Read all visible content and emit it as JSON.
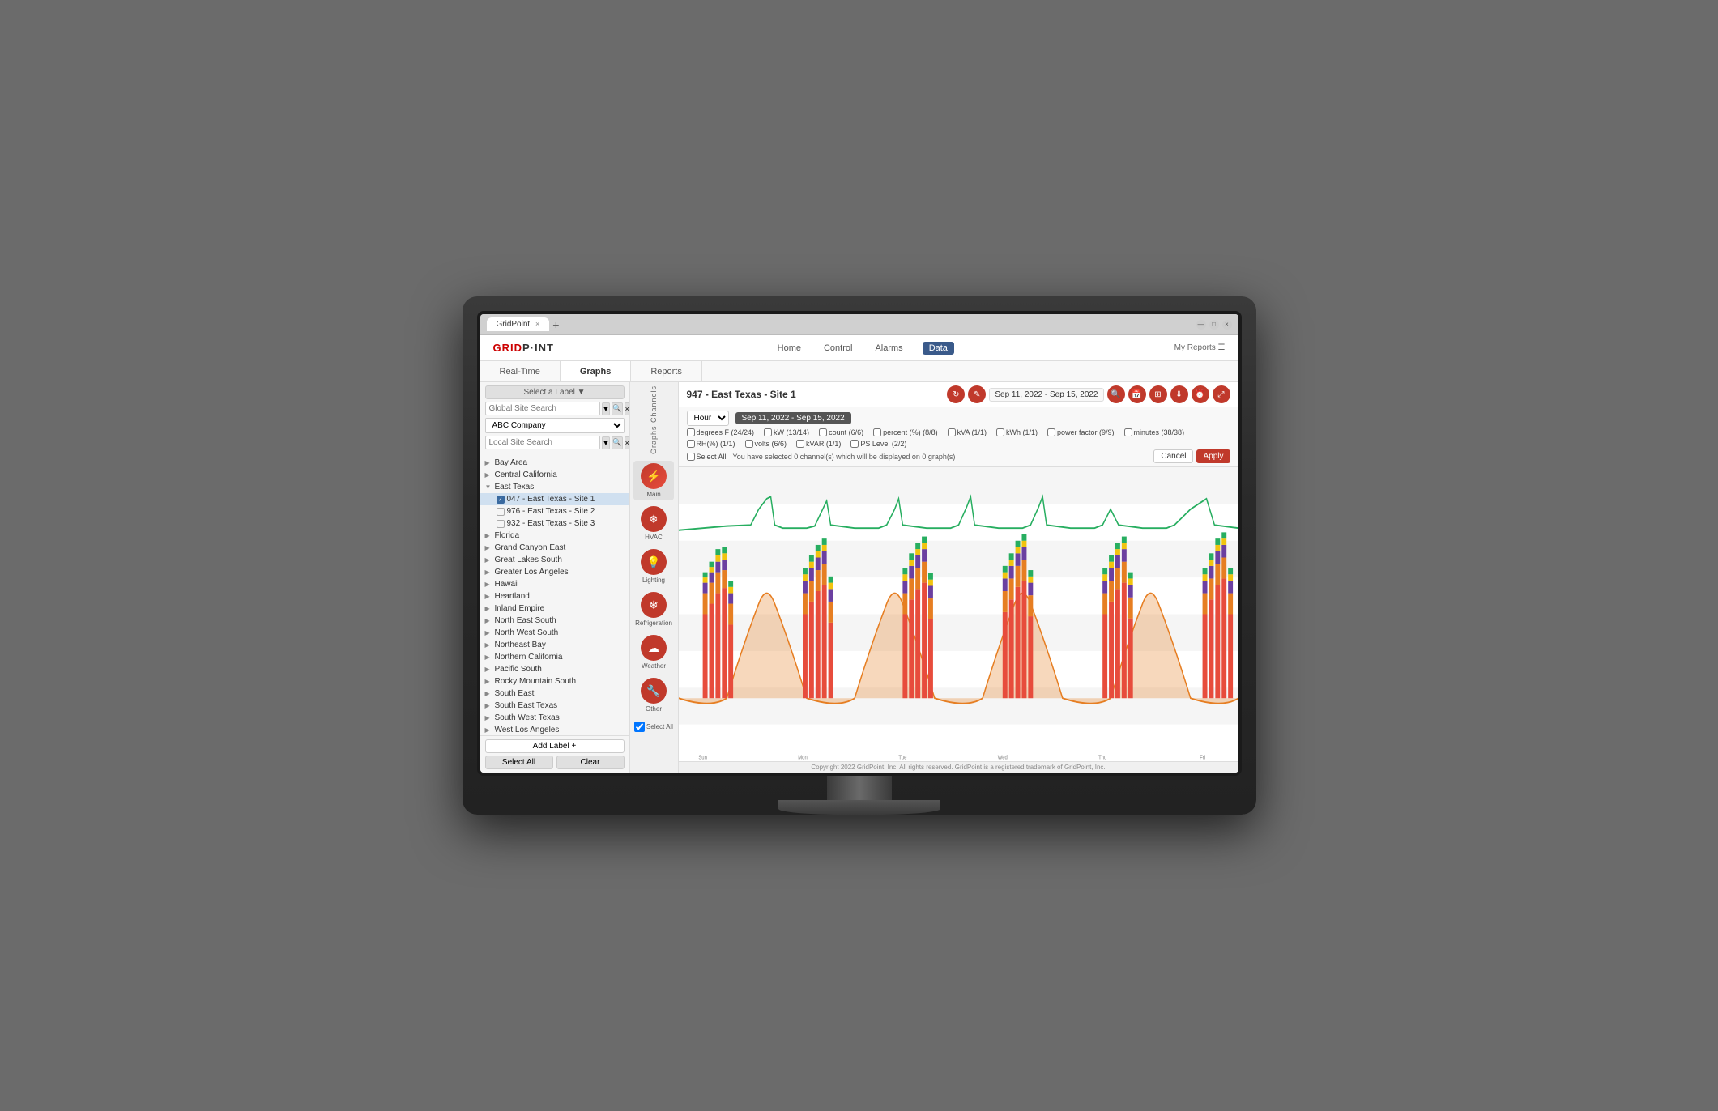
{
  "browser": {
    "tab_label": "GridPoint",
    "close_label": "×",
    "new_tab_label": "+",
    "minimize": "—",
    "maximize": "□",
    "close": "×"
  },
  "app": {
    "logo": "GRID",
    "logo_part2": "P·INT",
    "nav": {
      "home": "Home",
      "control": "Control",
      "alarms": "Alarms",
      "data": "Data",
      "my_reports": "My Reports ☰"
    },
    "sub_nav": {
      "realtime": "Real-Time",
      "graphs": "Graphs",
      "reports": "Reports"
    }
  },
  "sidebar": {
    "select_label": "Select a Label ▼",
    "global_search_placeholder": "Global Site Search",
    "company": "ABC Company",
    "local_search_placeholder": "Local Site Search",
    "tree_items": [
      {
        "label": "Bay Area",
        "level": 0,
        "has_children": true
      },
      {
        "label": "Central California",
        "level": 0,
        "has_children": true
      },
      {
        "label": "East Texas",
        "level": 0,
        "has_children": true,
        "expanded": true
      },
      {
        "label": "047 - East Texas - Site 1",
        "level": 1,
        "checked": true
      },
      {
        "label": "976 - East Texas - Site 2",
        "level": 1
      },
      {
        "label": "932 - East Texas - Site 3",
        "level": 1
      },
      {
        "label": "Florida",
        "level": 0,
        "has_children": true
      },
      {
        "label": "Grand Canyon East",
        "level": 0,
        "has_children": true
      },
      {
        "label": "Great Lakes South",
        "level": 0,
        "has_children": true
      },
      {
        "label": "Greater Los Angeles",
        "level": 0,
        "has_children": true
      },
      {
        "label": "Hawaii",
        "level": 0,
        "has_children": true
      },
      {
        "label": "Heartland",
        "level": 0,
        "has_children": true
      },
      {
        "label": "Inland Empire",
        "level": 0,
        "has_children": true
      },
      {
        "label": "North East South",
        "level": 0,
        "has_children": true
      },
      {
        "label": "North West South",
        "level": 0,
        "has_children": true
      },
      {
        "label": "Northeast Bay",
        "level": 0,
        "has_children": true
      },
      {
        "label": "Northern California",
        "level": 0,
        "has_children": true
      },
      {
        "label": "Pacific South",
        "level": 0,
        "has_children": true
      },
      {
        "label": "Rocky Mountain South",
        "level": 0,
        "has_children": true
      },
      {
        "label": "South East",
        "level": 0,
        "has_children": true
      },
      {
        "label": "South East Texas",
        "level": 0,
        "has_children": true
      },
      {
        "label": "South West Texas",
        "level": 0,
        "has_children": true
      },
      {
        "label": "West Los Angeles",
        "level": 0,
        "has_children": true
      }
    ],
    "add_label_btn": "Add Label +",
    "select_all_btn": "Select All",
    "clear_btn": "Clear"
  },
  "graph_channels": {
    "label": "Graphs Channels",
    "channels": [
      {
        "name": "Main",
        "icon": "⚡"
      },
      {
        "name": "HVAC",
        "icon": "❄"
      },
      {
        "name": "Lighting",
        "icon": "💡"
      },
      {
        "name": "Refrigeration",
        "icon": "❄"
      },
      {
        "name": "Weather",
        "icon": "☁"
      },
      {
        "name": "Other",
        "icon": "🔧"
      }
    ],
    "select_all": "Select All"
  },
  "data_panel": {
    "site_title": "947 - East Texas - Site 1",
    "date_range_display": "Sep 11, 2022 - Sep 15, 2022",
    "interval": "Hour",
    "date_btn_label": "Sep 11, 2022 - Sep 15, 2022",
    "checkboxes": [
      {
        "label": "degrees F (24/24)",
        "checked": false
      },
      {
        "label": "kW (13/14)",
        "checked": false
      },
      {
        "label": "count (6/6)",
        "checked": false
      },
      {
        "label": "percent (%) (8/8)",
        "checked": false
      },
      {
        "label": "kVA (1/1)",
        "checked": false
      },
      {
        "label": "kWh (1/1)",
        "checked": false
      },
      {
        "label": "power factor (9/9)",
        "checked": false
      },
      {
        "label": "minutes (38/38)",
        "checked": false
      },
      {
        "label": "RH(%) (1/1)",
        "checked": false
      },
      {
        "label": "volts (6/6)",
        "checked": false
      },
      {
        "label": "kVAR (1/1)",
        "checked": false
      },
      {
        "label": "PS Level (2/2)",
        "checked": false
      }
    ],
    "select_all_label": "Select All",
    "selection_info": "You have selected 0 channel(s) which will be displayed on 0 graph(s)",
    "cancel_btn": "Cancel",
    "apply_btn": "Apply"
  },
  "copyright": "Copyright 2022 GridPoint, Inc. All rights reserved. GridPoint is a registered trademark of GridPoint, Inc.",
  "colors": {
    "brand_red": "#c0392b",
    "nav_blue": "#3a5a8a",
    "bar_purple": "#6b3fa0",
    "bar_yellow": "#f1c40f",
    "bar_green": "#27ae60",
    "bar_red": "#e74c3c",
    "line_green": "#27ae60",
    "line_orange": "#e67e22",
    "bar_blue": "#2980b9"
  }
}
